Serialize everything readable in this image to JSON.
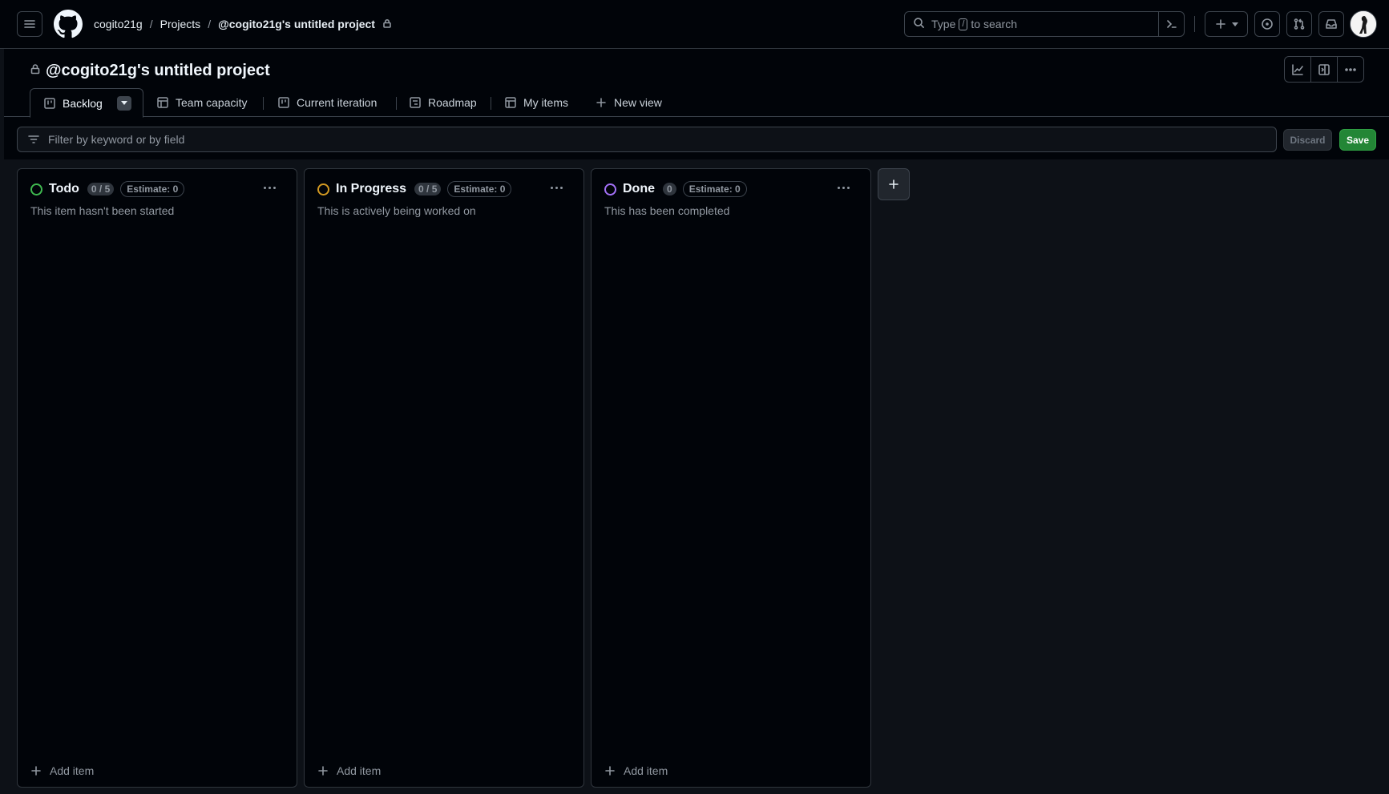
{
  "breadcrumb": {
    "owner": "cogito21g",
    "section": "Projects",
    "project": "@cogito21g's untitled project",
    "separator": "/"
  },
  "search": {
    "prefix": "Type",
    "key": "/",
    "suffix": "to search"
  },
  "project": {
    "title": "@cogito21g's untitled project"
  },
  "tabs": [
    {
      "label": "Backlog",
      "icon": "board-icon",
      "active": true
    },
    {
      "label": "Team capacity",
      "icon": "table-icon"
    },
    {
      "label": "Current iteration",
      "icon": "board-icon"
    },
    {
      "label": "Roadmap",
      "icon": "roadmap-icon"
    },
    {
      "label": "My items",
      "icon": "table-icon"
    },
    {
      "label": "New view",
      "icon": "plus-icon"
    }
  ],
  "filter": {
    "placeholder": "Filter by keyword or by field"
  },
  "actions": {
    "discard": "Discard",
    "save": "Save"
  },
  "columns": [
    {
      "name": "Todo",
      "count": "0 / 5",
      "estimate": "Estimate: 0",
      "description": "This item hasn't been started",
      "color": "#3fb950",
      "add_label": "Add item"
    },
    {
      "name": "In Progress",
      "count": "0 / 5",
      "estimate": "Estimate: 0",
      "description": "This is actively being worked on",
      "color": "#d29922",
      "add_label": "Add item"
    },
    {
      "name": "Done",
      "count": "0",
      "estimate": "Estimate: 0",
      "description": "This has been completed",
      "color": "#a371f7",
      "add_label": "Add item"
    }
  ]
}
